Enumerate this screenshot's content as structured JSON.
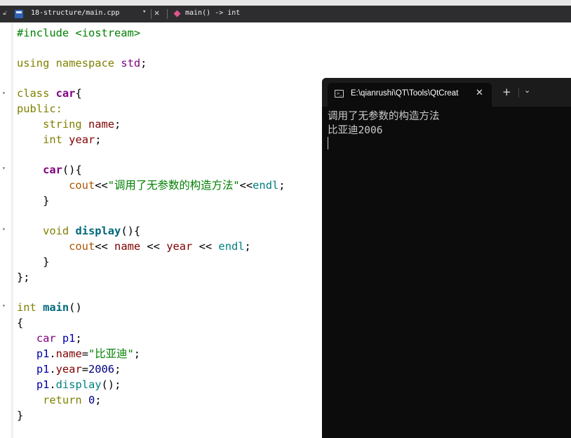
{
  "tab": {
    "file_name": "18-structure/main.cpp",
    "function": "main() -> int",
    "close_glyph": "✕",
    "dropdown_glyph": "▾"
  },
  "code": {
    "include_directive": "#include",
    "include_header": "<iostream>",
    "using_kw": "using",
    "namespace_kw": "namespace",
    "std_ns": "std",
    "class_kw": "class",
    "class_name": "car",
    "brace_open": "{",
    "brace_close": "}",
    "class_end": "};",
    "public_kw": "public:",
    "string_type": "string",
    "name_field": "name",
    "int_type": "int",
    "year_field": "year",
    "ctor_name": "car",
    "cout": "cout",
    "stream_op": "<<",
    "ctor_msg": "\"调用了无参数的构造方法\"",
    "endl": "endl",
    "void_kw": "void",
    "display_fn": "display",
    "main_fn": "main",
    "parens": "()",
    "obj_decl_type": "car",
    "obj_var": "p1",
    "name_value": "\"比亚迪\"",
    "year_value": "2006",
    "return_kw": "return",
    "return_value": "0"
  },
  "terminal": {
    "tab_title": "E:\\qianrushi\\QT\\Tools\\QtCreat",
    "close_glyph": "✕",
    "add_glyph": "+",
    "dropdown_glyph": "⌄",
    "output_lines": [
      "调用了无参数的构造方法",
      "比亚迪2006"
    ]
  }
}
